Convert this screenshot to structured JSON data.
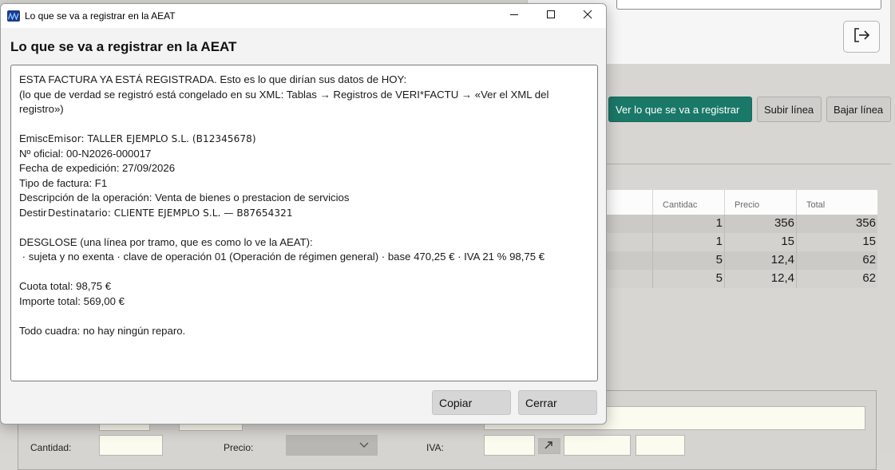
{
  "background": {
    "buttons": {
      "ver": "Ver lo que se va a registrar",
      "subir": "Subir línea",
      "bajar": "Bajar línea"
    },
    "table": {
      "headers": [
        "Cantidac",
        "Precio",
        "Total"
      ],
      "rows": [
        [
          "1",
          "356",
          "356"
        ],
        [
          "1",
          "15",
          "15"
        ],
        [
          "5",
          "12,4",
          "62"
        ],
        [
          "5",
          "12,4",
          "62"
        ]
      ]
    },
    "form": {
      "cantidad_label": "Cantidad:",
      "precio_label": "Precio:",
      "iva_label": "IVA:"
    }
  },
  "dialog": {
    "window_title": "Lo que se va a registrar en la AEAT",
    "heading": "Lo que se va a registrar en la AEAT",
    "report": {
      "line1": "ESTA FACTURA YA ESTÁ REGISTRADA. Esto es lo que dirían sus datos de HOY:",
      "line2": "(lo que de verdad se registró está congelado en su XML: Tablas → Registros de VERI*FACTU → «Ver el XML del registro»)",
      "emisor_under": "Emisc",
      "emisor": "Emisor: TALLER EJEMPLO S.L. (B12345678)",
      "numero": "Nº oficial: 00-N2026-000017",
      "fecha": "Fecha de expedición: 27/09/2026",
      "tipo": "Tipo de factura: F1",
      "descripcion": "Descripción de la operación: Venta de bienes o prestacion de servicios",
      "destinatario_under": "Destir",
      "destinatario": "Destinatario: CLIENTE EJEMPLO S.L. — B87654321",
      "desglose_title": "DESGLOSE (una línea por tramo, que es como lo ve la AEAT):",
      "desglose_line": " · sujeta y no exenta · clave de operación 01 (Operación de régimen general) · base 470,25 € · IVA 21 % 98,75 €",
      "cuota": "Cuota total: 98,75 €",
      "importe": "Importe total: 569,00 €",
      "conclusion": "Todo cuadra: no hay ningún reparo."
    },
    "buttons": {
      "copiar": "Copiar",
      "cerrar": "Cerrar"
    }
  }
}
